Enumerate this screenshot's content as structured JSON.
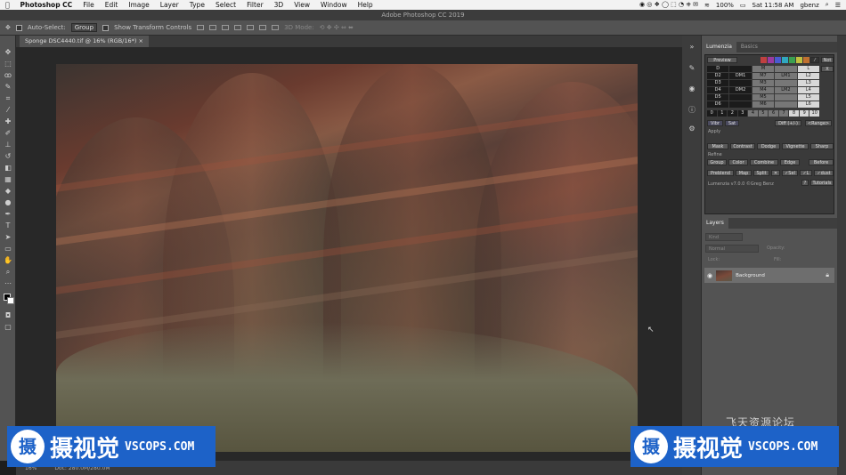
{
  "menubar": {
    "app": "Photoshop CC",
    "items": [
      "File",
      "Edit",
      "Image",
      "Layer",
      "Type",
      "Select",
      "Filter",
      "3D",
      "View",
      "Window",
      "Help"
    ],
    "battery": "100%",
    "clock": "Sat 11:58 AM",
    "user": "gbenz"
  },
  "window_title": "Adobe Photoshop CC 2019",
  "options": {
    "auto_select": "Auto-Select:",
    "auto_select_value": "Group",
    "show_transform": "Show Transform Controls",
    "mode_3d": "3D Mode:"
  },
  "document": {
    "tab": "Sponge DSC4440.tif @ 16% (RGB/16*)",
    "zoom": "16%",
    "doc_size": "Doc: 280.0M/280.0M"
  },
  "panels": {
    "lumenzia_tab": "Lumenzia",
    "basics_tab": "Basics",
    "preview": "Preview",
    "not": "Not",
    "x": "X",
    "rows": [
      [
        "D",
        "",
        "M",
        "",
        "L"
      ],
      [
        "D2",
        "DM1",
        "M7",
        "LM1",
        "L2"
      ],
      [
        "D3",
        "",
        "M3",
        "",
        "L3"
      ],
      [
        "D4",
        "DM2",
        "M4",
        "LM2",
        "L4"
      ],
      [
        "D5",
        "",
        "M5",
        "",
        "L5"
      ],
      [
        "D6",
        "",
        "M6",
        "",
        "L6"
      ]
    ],
    "zone_row": [
      "0",
      "1",
      "2",
      "3",
      "4",
      "5",
      "6",
      "7",
      "8",
      "9",
      "10"
    ],
    "vibr": "Vibr",
    "sat": "Sat",
    "diff": "Diff (+/-)",
    "range": "<Range>",
    "apply_label": "Apply",
    "apply_buttons": [
      "Mask",
      "Contrast",
      "Dodge",
      "Vignette",
      "Sharp"
    ],
    "refine_label": "Refine",
    "refine_buttons": [
      "Group",
      "Color",
      "Combine",
      "Edge",
      "Before"
    ],
    "bottom_buttons": [
      "Preblend",
      "Map",
      "Split",
      "✕",
      "✓Sel",
      "✓L",
      "✓dust"
    ],
    "version": "Lumenzia v7.0.0 ©Greg Benz",
    "help": "?",
    "tutorials": "Tutorials",
    "layers_tab": "Layers",
    "kind": "Kind",
    "normal": "Normal",
    "opacity": "Opacity:",
    "lock": "Lock:",
    "fill": "Fill:",
    "background_layer": "Background"
  },
  "watermark": {
    "cn": "摄视觉",
    "en": "VSCOPS.COM",
    "logo": "摄",
    "forum": "飞天资源论坛"
  }
}
